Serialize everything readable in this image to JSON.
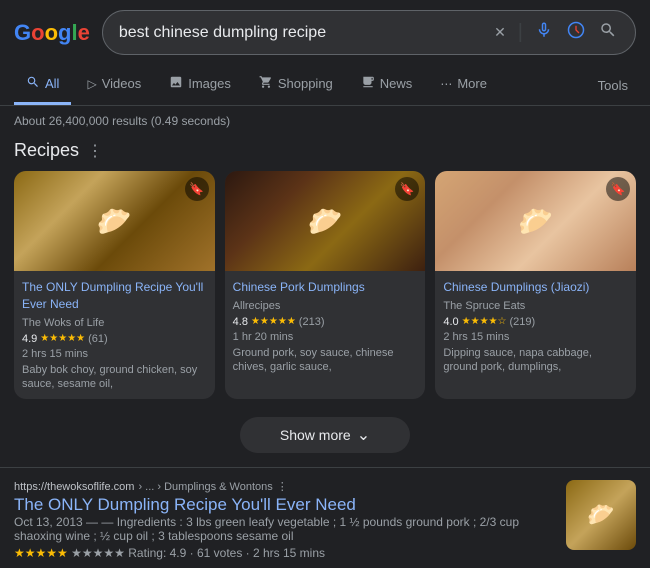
{
  "header": {
    "logo_letters": [
      "G",
      "o",
      "o",
      "g",
      "l",
      "e"
    ],
    "search_value": "best chinese dumpling recipe",
    "clear_icon": "✕",
    "mic_icon": "🎙",
    "lens_icon": "⬡",
    "search_icon": "🔍"
  },
  "nav": {
    "tabs": [
      {
        "id": "all",
        "label": "All",
        "icon": "🔍",
        "active": true
      },
      {
        "id": "videos",
        "label": "Videos",
        "icon": "▷"
      },
      {
        "id": "images",
        "label": "Images",
        "icon": "🖼"
      },
      {
        "id": "shopping",
        "label": "Shopping",
        "icon": "🛍"
      },
      {
        "id": "news",
        "label": "News",
        "icon": "📰"
      },
      {
        "id": "more",
        "label": "More",
        "icon": "⋮"
      }
    ],
    "tools_label": "Tools"
  },
  "results_count": "About 26,400,000 results (0.49 seconds)",
  "recipes_section": {
    "title": "Recipes",
    "menu_icon": "⋮",
    "cards": [
      {
        "id": "card-1",
        "title": "The ONLY Dumpling Recipe You'll Ever Need",
        "source": "The Woks of Life",
        "rating": "4.9",
        "stars": "★★★★★",
        "count": "(61)",
        "time": "2 hrs 15 mins",
        "ingredients": "Baby bok choy, ground chicken, soy sauce, sesame oil,"
      },
      {
        "id": "card-2",
        "title": "Chinese Pork Dumplings",
        "source": "Allrecipes",
        "rating": "4.8",
        "stars": "★★★★★",
        "count": "(213)",
        "time": "1 hr 20 mins",
        "ingredients": "Ground pork, soy sauce, chinese chives, garlic sauce,"
      },
      {
        "id": "card-3",
        "title": "Chinese Dumplings (Jiaozi)",
        "source": "The Spruce Eats",
        "rating": "4.0",
        "stars": "★★★★☆",
        "count": "(219)",
        "time": "2 hrs 15 mins",
        "ingredients": "Dipping sauce, napa cabbage, ground pork, dumplings,"
      }
    ],
    "show_more_label": "Show more",
    "chevron": "⌄"
  },
  "web_result": {
    "url_base": "https://thewoksoflife.com",
    "url_path": "› ... › Dumplings & Wontons",
    "more_icon": "⋮",
    "title": "The ONLY Dumpling Recipe You'll Ever Need",
    "date": "Oct 13, 2013",
    "snippet": "— Ingredients : 3 lbs green leafy vegetable ; 1 ½ pounds ground pork ; 2/3 cup shaoxing wine ; ½ cup oil ; 3 tablespoons sesame oil",
    "meta": "★★★★★ Rating: 4.9 · 61 votes · 2 hrs 15 mins"
  }
}
